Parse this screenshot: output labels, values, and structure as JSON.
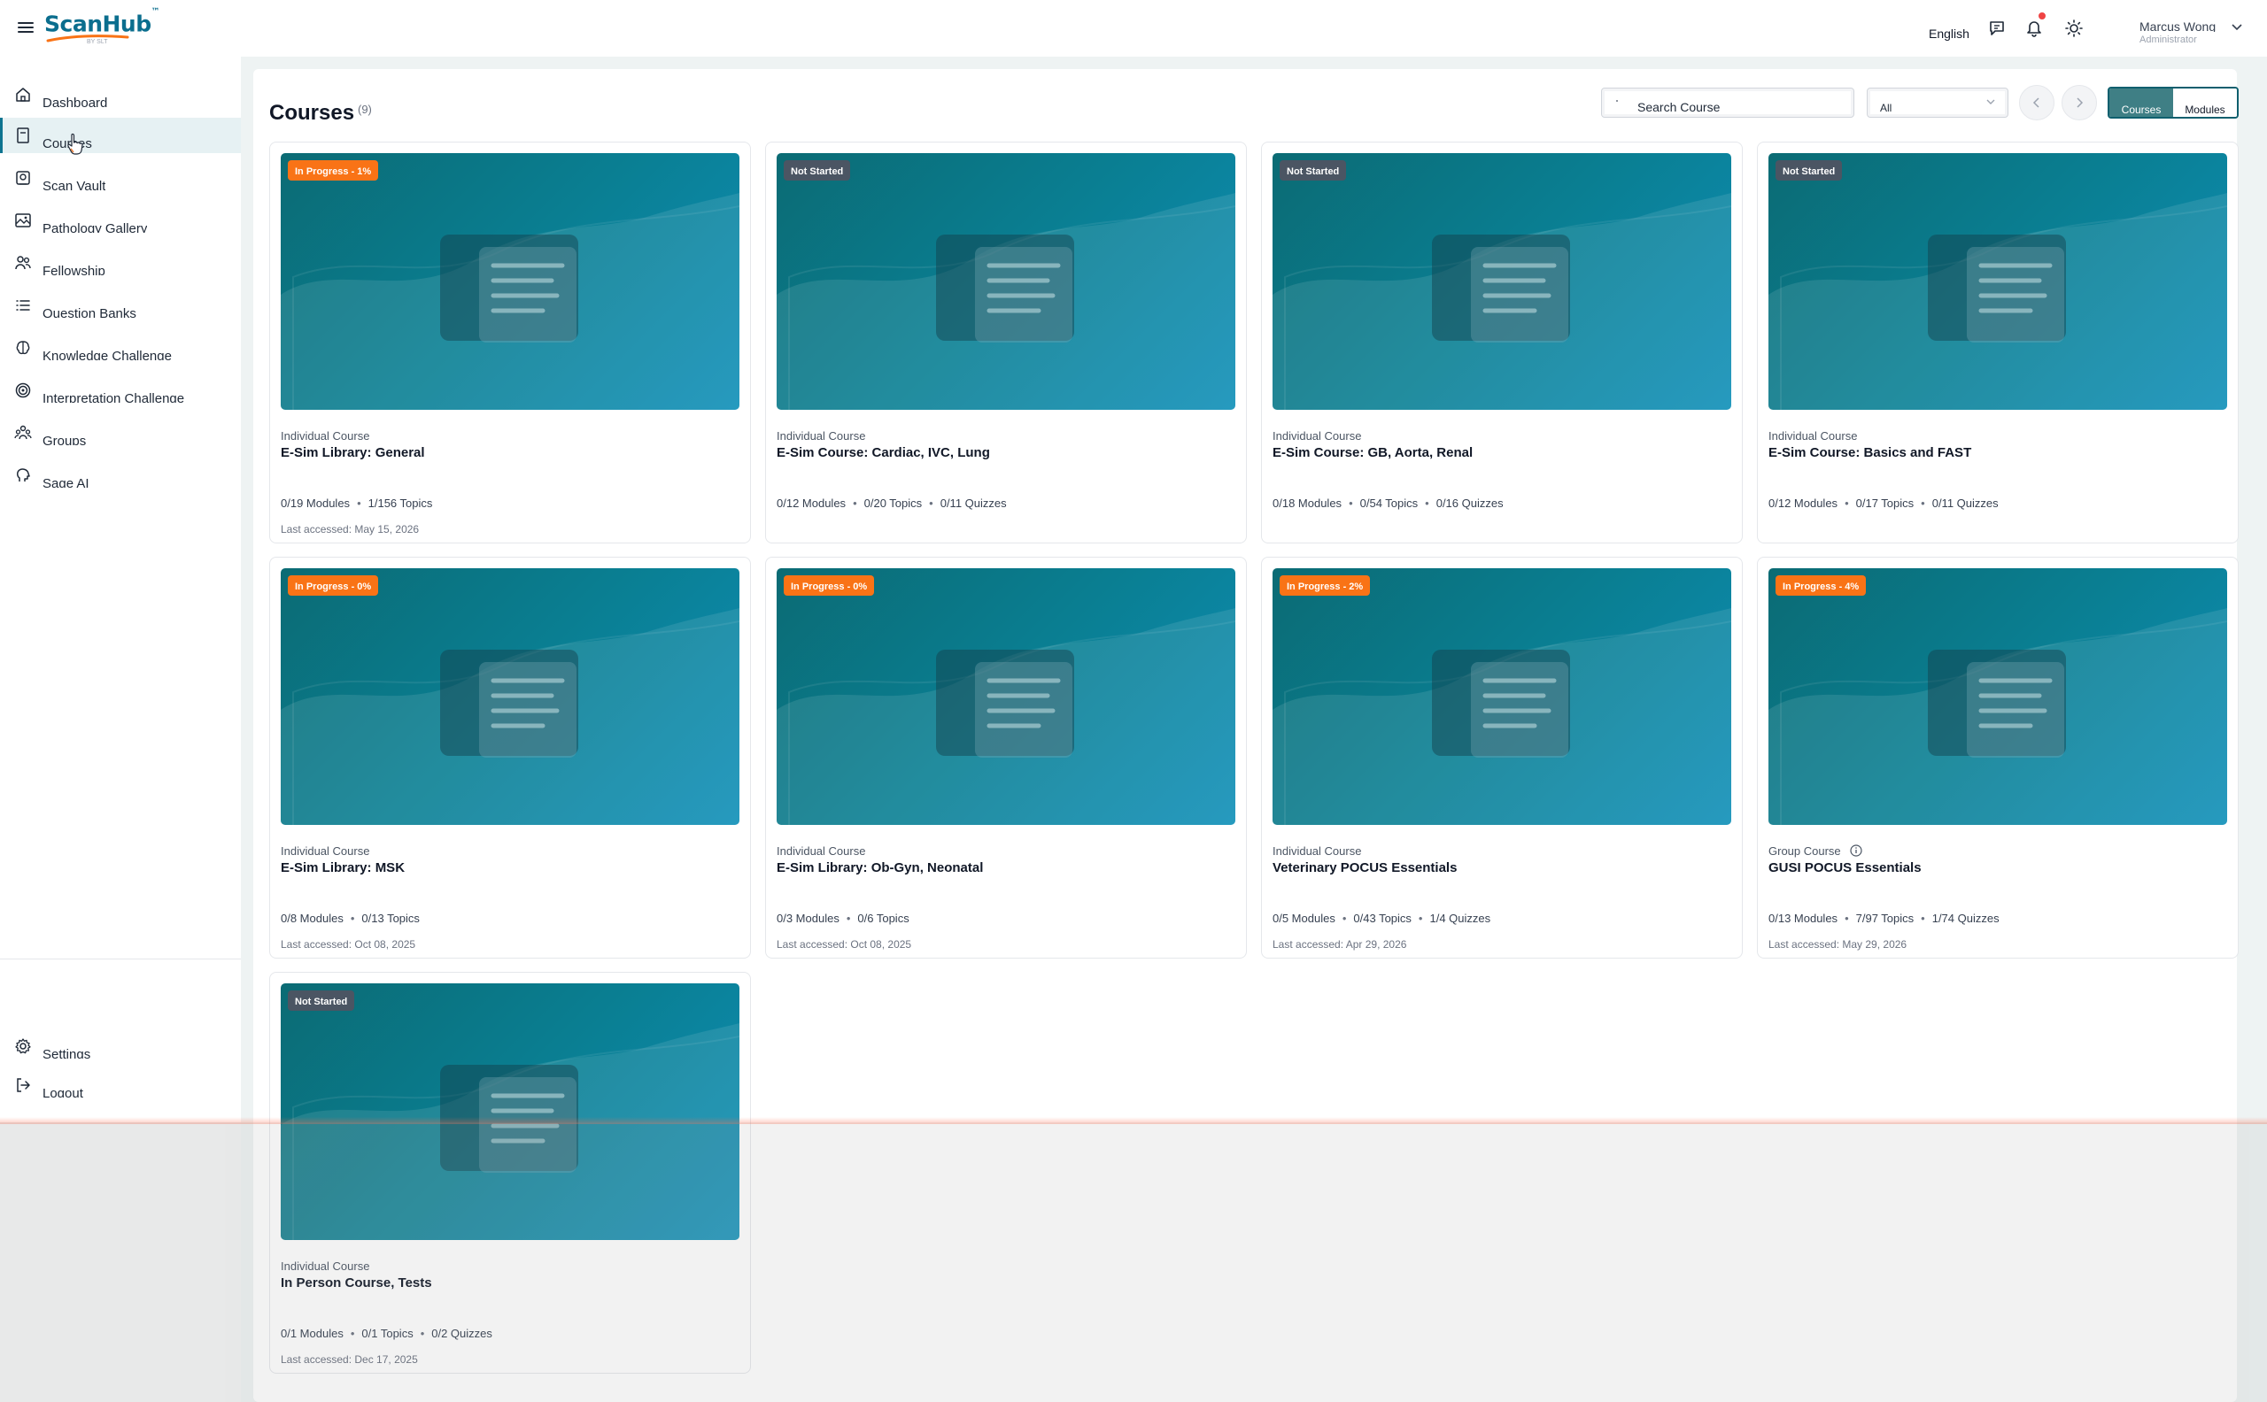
{
  "app": {
    "logo_text": "ScanHub",
    "logo_sub": "BY SLT",
    "brand_color": "#0b6e8e",
    "accent_color": "#f97316"
  },
  "header": {
    "language": "English",
    "user_name": "Marcus Wong",
    "user_role": "Administrator",
    "icons": [
      "menu-icon",
      "chat-icon",
      "bell-icon",
      "theme-sun-icon",
      "chevron-down-icon"
    ]
  },
  "sidebar": {
    "items": [
      {
        "label": "Dashboard",
        "icon": "home-icon"
      },
      {
        "label": "Courses",
        "icon": "book-icon",
        "active": true
      },
      {
        "label": "Scan Vault",
        "icon": "vault-icon"
      },
      {
        "label": "Pathology Gallery",
        "icon": "image-icon"
      },
      {
        "label": "Fellowship",
        "icon": "users-icon"
      },
      {
        "label": "Question Banks",
        "icon": "list-icon"
      },
      {
        "label": "Knowledge Challenge",
        "icon": "brain-icon"
      },
      {
        "label": "Interpretation Challenge",
        "icon": "target-icon"
      },
      {
        "label": "Groups",
        "icon": "group-icon"
      },
      {
        "label": "Sage AI",
        "icon": "ai-head-icon"
      }
    ],
    "bottom": [
      {
        "label": "Settings",
        "icon": "gear-icon"
      },
      {
        "label": "Logout",
        "icon": "logout-icon"
      }
    ]
  },
  "main": {
    "title": "Courses",
    "count": "(9)",
    "search_placeholder": "Search Course",
    "filter_value": "All",
    "view_toggle": {
      "courses": "Courses",
      "modules": "Modules"
    }
  },
  "courses": [
    {
      "status": "In Progress - 1%",
      "status_kind": "progress",
      "type": "Individual Course",
      "title": "E-Sim Library: General",
      "stats": [
        "0/19 Modules",
        "1/156 Topics"
      ],
      "last": "Last accessed: May 15, 2026"
    },
    {
      "status": "Not Started",
      "status_kind": "notstarted",
      "type": "Individual Course",
      "title": "E-Sim Course: Cardiac, IVC, Lung",
      "stats": [
        "0/12 Modules",
        "0/20 Topics",
        "0/11 Quizzes"
      ],
      "last": ""
    },
    {
      "status": "Not Started",
      "status_kind": "notstarted",
      "type": "Individual Course",
      "title": "E-Sim Course: GB, Aorta, Renal",
      "stats": [
        "0/18 Modules",
        "0/54 Topics",
        "0/16 Quizzes"
      ],
      "last": ""
    },
    {
      "status": "Not Started",
      "status_kind": "notstarted",
      "type": "Individual Course",
      "title": "E-Sim Course: Basics and FAST",
      "stats": [
        "0/12 Modules",
        "0/17 Topics",
        "0/11 Quizzes"
      ],
      "last": ""
    },
    {
      "status": "In Progress - 0%",
      "status_kind": "progress",
      "type": "Individual Course",
      "title": "E-Sim Library: MSK",
      "stats": [
        "0/8 Modules",
        "0/13 Topics"
      ],
      "last": "Last accessed: Oct 08, 2025"
    },
    {
      "status": "In Progress - 0%",
      "status_kind": "progress",
      "type": "Individual Course",
      "title": "E-Sim Library: Ob-Gyn, Neonatal",
      "stats": [
        "0/3 Modules",
        "0/6 Topics"
      ],
      "last": "Last accessed: Oct 08, 2025"
    },
    {
      "status": "In Progress - 2%",
      "status_kind": "progress",
      "type": "Individual Course",
      "title": "Veterinary POCUS Essentials",
      "stats": [
        "0/5 Modules",
        "0/43 Topics",
        "1/4 Quizzes"
      ],
      "last": "Last accessed: Apr 29, 2026"
    },
    {
      "status": "In Progress - 4%",
      "status_kind": "progress",
      "type": "Group Course",
      "title": "GUSI POCUS Essentials",
      "stats": [
        "0/13 Modules",
        "7/97 Topics",
        "1/74 Quizzes"
      ],
      "last": "Last accessed: May 29, 2026",
      "info": true
    },
    {
      "status": "Not Started",
      "status_kind": "notstarted",
      "type": "Individual Course",
      "title": "In Person Course, Tests",
      "stats": [
        "0/1 Modules",
        "0/1 Topics",
        "0/2 Quizzes"
      ],
      "last": "Last accessed: Dec 17, 2025"
    }
  ]
}
